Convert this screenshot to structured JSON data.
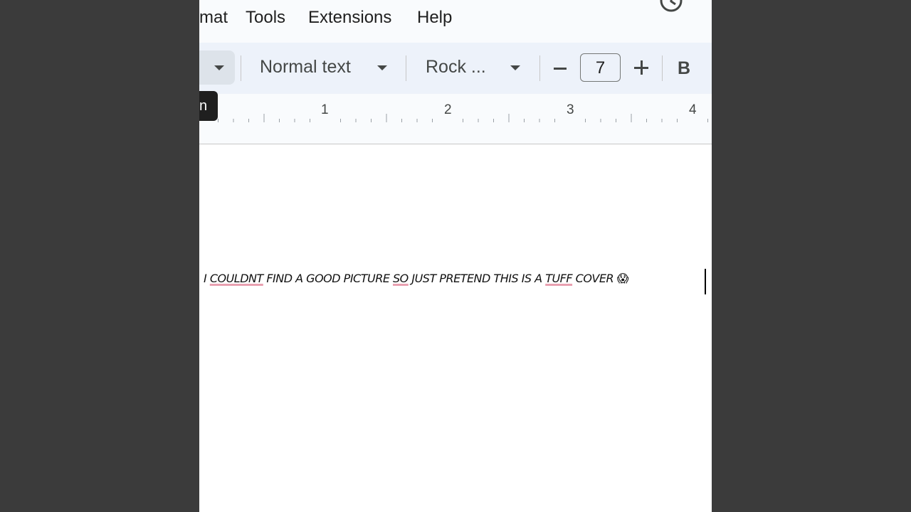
{
  "menu": {
    "format": "mat",
    "tools": "Tools",
    "extensions": "Extensions",
    "help": "Help"
  },
  "toolbar": {
    "paragraph_style": "Normal text",
    "font_name": "Rock ...",
    "font_size": "7",
    "bold_label": "B"
  },
  "ruler": {
    "marks": [
      "1",
      "2",
      "3",
      "4"
    ]
  },
  "tooltip": {
    "text": "n"
  },
  "document": {
    "prefix": "I ",
    "misspelled_1": "COULDNT",
    "text_1": " FIND A GOOD PICTURE ",
    "misspelled_2": "SO",
    "text_2": " JUST PRETEND THIS IS A ",
    "misspelled_3": "TUFF",
    "text_3": " COVER ",
    "emoji": "😱"
  },
  "icons": {
    "history": "history-icon",
    "dropdown": "chevron-down-icon"
  },
  "colors": {
    "spellcheck_underline": "#e8a0b0",
    "toolbar_bg": "#edf2fa",
    "menubar_bg": "#f9fbfd",
    "outer_bg": "#3b3b3b"
  }
}
